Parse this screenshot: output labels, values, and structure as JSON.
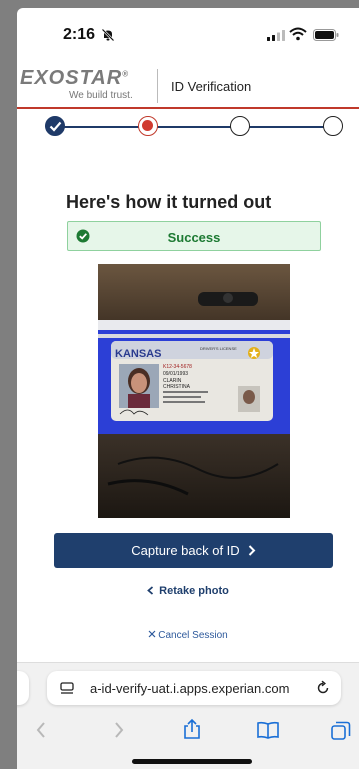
{
  "status": {
    "time": "2:16"
  },
  "header": {
    "logo_text": "EXOSTAR",
    "logo_reg": "®",
    "tagline": "We build trust.",
    "title": "ID Verification"
  },
  "main": {
    "title": "Here's how it turned out",
    "status_text": "Success",
    "capture_label": "Capture back of ID",
    "retake_label": "Retake photo",
    "cancel_label": "Cancel Session"
  },
  "photo": {
    "state_label": "KANSAS",
    "license_label": "DRIVER'S LICENSE",
    "license_number": "K12-34-5678",
    "dob": "09/01/1993",
    "surname": "CLARIN",
    "given_name": "CHRISTINA"
  },
  "browser": {
    "url": "a-id-verify-uat.i.apps.experian.com"
  },
  "colors": {
    "accent": "#1f3f6d",
    "step_active": "#d03a2f",
    "success_bg": "#e6f6e9",
    "success_text": "#1d7a33"
  },
  "stepper": {
    "total_steps": 4,
    "completed_steps": 1,
    "current_step": 2
  },
  "icons": [
    "bell-off-icon",
    "signal-icon",
    "wifi-icon",
    "battery-icon",
    "check-icon",
    "success-check-icon",
    "chevron-right-icon",
    "chevron-left-icon",
    "close-icon",
    "page-icon",
    "reload-icon",
    "back-icon",
    "forward-icon",
    "share-icon",
    "bookmarks-icon",
    "tabs-icon"
  ]
}
